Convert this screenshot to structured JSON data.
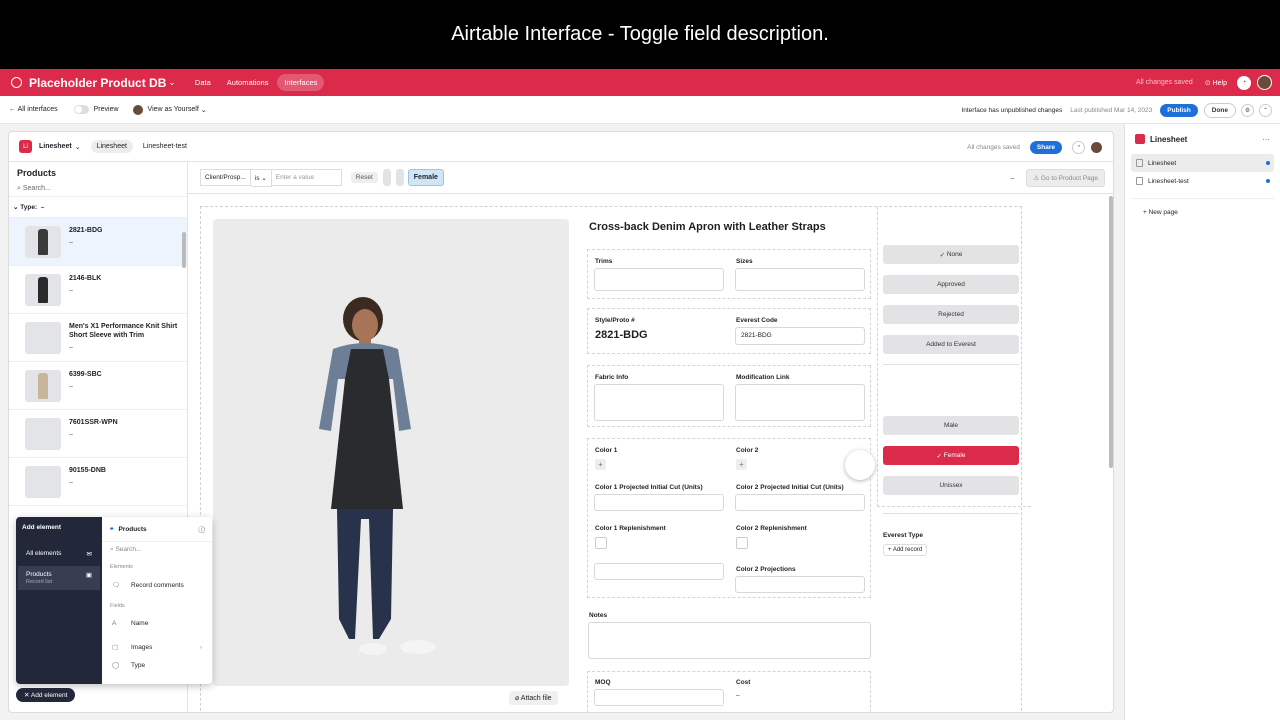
{
  "caption": "Airtable Interface - Toggle field description.",
  "topbar": {
    "base_name": "Placeholder Product DB",
    "nav": [
      "Data",
      "Automations",
      "Interfaces"
    ],
    "saved": "All changes saved",
    "help": "Help",
    "accent": "#dc2a4b"
  },
  "subbar": {
    "back": "All interfaces",
    "preview": "Preview",
    "view_as": "View as Yourself",
    "unpublished": "Interface has unpublished changes",
    "last_published": "Last published Mar 14, 2023",
    "publish": "Publish",
    "done": "Done"
  },
  "interface": {
    "badge": "Li",
    "name": "Linesheet",
    "tab_active": "Linesheet",
    "tab_other": "Linesheet-test",
    "saved": "All changes saved",
    "share": "Share"
  },
  "records_panel": {
    "title": "Products",
    "search": "Search...",
    "group_label": "Type:",
    "group_value": "–",
    "records": [
      {
        "name": "2821-BDG",
        "sub": "–"
      },
      {
        "name": "2146-BLK",
        "sub": "–"
      },
      {
        "name": "Men's X1 Performance Knit Shirt Short Sleeve with Trim",
        "sub": "–"
      },
      {
        "name": "6399-SBC",
        "sub": "–"
      },
      {
        "name": "7601SSR-WPN",
        "sub": "–"
      },
      {
        "name": "90155-DNB",
        "sub": "–"
      }
    ]
  },
  "filter_bar": {
    "field": "Client/Prosp...",
    "operator": "is",
    "value_placeholder": "Enter a value",
    "reset": "Reset",
    "active_pill": "Female",
    "dash": "–",
    "goto": "Go to Product Page"
  },
  "record": {
    "title": "Cross-back Denim Apron with Leather Straps",
    "attach": "Attach file",
    "fields": {
      "trims": "Trims",
      "sizes": "Sizes",
      "style_proto": "Style/Proto #",
      "style_value": "2821-BDG",
      "everest_code": "Everest Code",
      "everest_value": "2821-BDG",
      "fabric_info": "Fabric Info",
      "mod_link": "Modification Link",
      "color1": "Color 1",
      "color2": "Color 2",
      "c1_cut": "Color 1 Projected Initial Cut (Units)",
      "c2_cut": "Color 2 Projected Initial Cut (Units)",
      "c1_rep": "Color 1 Replenishment",
      "c2_rep": "Color 2 Replenishment",
      "c2_proj": "Color 2 Projections",
      "notes": "Notes",
      "moq": "MOQ",
      "cost": "Cost",
      "cost_value": "–",
      "everest_type": "Everest Type",
      "add_record": "+ Add record"
    },
    "status_buttons": [
      "None",
      "Approved",
      "Rejected",
      "Added to Everest"
    ],
    "gender_buttons": [
      "Male",
      "Female",
      "Unissex"
    ]
  },
  "pages_panel": {
    "title": "Linesheet",
    "pages": [
      "Linesheet",
      "Linesheet-test"
    ],
    "new_page": "+ New page"
  },
  "add_element": {
    "title": "Add element",
    "all_elements": "All elements",
    "products": "Products",
    "record_list": "Record list",
    "source": "Products",
    "search": "Search...",
    "group_elements": "Elements",
    "record_comments": "Record comments",
    "group_fields": "Fields",
    "name_field": "Name",
    "images_field": "Images",
    "type_field": "Type",
    "button": "Add element"
  }
}
